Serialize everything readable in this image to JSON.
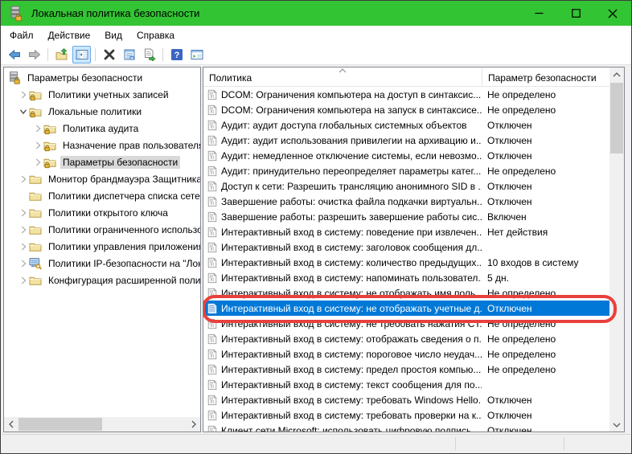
{
  "window": {
    "title": "Локальная политика безопасности"
  },
  "titlebar": {
    "icons": [
      "app-icon-secpol",
      "minimize-icon",
      "maximize-icon",
      "close-icon"
    ]
  },
  "menu": {
    "items": [
      "Файл",
      "Действие",
      "Вид",
      "Справка"
    ]
  },
  "toolbar": {
    "buttons": [
      {
        "name": "back",
        "enabled": true
      },
      {
        "name": "forward",
        "enabled": false
      },
      {
        "name": "up-one-level",
        "enabled": true
      },
      {
        "name": "show-console-tree",
        "enabled": true,
        "active": true
      },
      {
        "name": "delete",
        "enabled": true
      },
      {
        "name": "properties",
        "enabled": true
      },
      {
        "name": "export-list",
        "enabled": true
      },
      {
        "name": "help",
        "enabled": true
      },
      {
        "name": "new-window",
        "enabled": true
      }
    ]
  },
  "tree": {
    "items": [
      {
        "label": "Параметры безопасности",
        "level": 0,
        "expander": "none",
        "icon": "root",
        "selected": false
      },
      {
        "label": "Политики учетных записей",
        "level": 1,
        "expander": "collapsed",
        "icon": "folder-lock",
        "selected": false
      },
      {
        "label": "Локальные политики",
        "level": 1,
        "expander": "expanded",
        "icon": "folder-lock",
        "selected": false
      },
      {
        "label": "Политика аудита",
        "level": 2,
        "expander": "collapsed",
        "icon": "folder-lock",
        "selected": false
      },
      {
        "label": "Назначение прав пользователя",
        "level": 2,
        "expander": "collapsed",
        "icon": "folder-lock",
        "selected": false
      },
      {
        "label": "Параметры безопасности",
        "level": 2,
        "expander": "collapsed",
        "icon": "folder-lock",
        "selected": true
      },
      {
        "label": "Монитор брандмауэра Защитника W",
        "level": 1,
        "expander": "collapsed",
        "icon": "folder",
        "selected": false
      },
      {
        "label": "Политики диспетчера списка сетей",
        "level": 1,
        "expander": "none",
        "icon": "folder",
        "selected": false
      },
      {
        "label": "Политики открытого ключа",
        "level": 1,
        "expander": "collapsed",
        "icon": "folder",
        "selected": false
      },
      {
        "label": "Политики ограниченного использо",
        "level": 1,
        "expander": "collapsed",
        "icon": "folder",
        "selected": false
      },
      {
        "label": "Политики управления приложения",
        "level": 1,
        "expander": "collapsed",
        "icon": "folder",
        "selected": false
      },
      {
        "label": "Политики IP-безопасности на \"Лока",
        "level": 1,
        "expander": "collapsed",
        "icon": "ipsec",
        "selected": false
      },
      {
        "label": "Конфигурация расширенной полит",
        "level": 1,
        "expander": "collapsed",
        "icon": "folder",
        "selected": false
      }
    ]
  },
  "list": {
    "columns": [
      "Политика",
      "Параметр безопасности"
    ],
    "sorted_column": "Политика",
    "rows": [
      {
        "policy": "DCOM: Ограничения компьютера на доступ в синтаксис...",
        "value": "Не определено",
        "selected": false
      },
      {
        "policy": "DCOM: Ограничения компьютера на запуск в синтаксисе...",
        "value": "Не определено",
        "selected": false
      },
      {
        "policy": "Аудит: аудит доступа глобальных системных объектов",
        "value": "Отключен",
        "selected": false
      },
      {
        "policy": "Аудит: аудит использования привилегии на архивацию и...",
        "value": "Отключен",
        "selected": false
      },
      {
        "policy": "Аудит: немедленное отключение системы, если невозмо...",
        "value": "Отключен",
        "selected": false
      },
      {
        "policy": "Аудит: принудительно переопределяет параметры катег...",
        "value": "Не определено",
        "selected": false
      },
      {
        "policy": "Доступ к сети: Разрешить трансляцию анонимного SID в ...",
        "value": "Отключен",
        "selected": false
      },
      {
        "policy": "Завершение работы: очистка файла подкачки виртуальн...",
        "value": "Отключен",
        "selected": false
      },
      {
        "policy": "Завершение работы: разрешить завершение работы сис...",
        "value": "Включен",
        "selected": false
      },
      {
        "policy": "Интерактивный вход в систему:  поведение при извлечен...",
        "value": "Нет действия",
        "selected": false
      },
      {
        "policy": "Интерактивный вход в систему: заголовок сообщения дл...",
        "value": "",
        "selected": false
      },
      {
        "policy": "Интерактивный вход в систему: количество предыдущих...",
        "value": "10 входов в систему",
        "selected": false
      },
      {
        "policy": "Интерактивный вход в систему: напоминать пользовател...",
        "value": "5 дн.",
        "selected": false
      },
      {
        "policy": "Интерактивный вход в систему: не отображать имя поль...",
        "value": "Не определено",
        "selected": false
      },
      {
        "policy": "Интерактивный вход в систему: не отображать учетные д...",
        "value": "Отключен",
        "selected": true
      },
      {
        "policy": "Интерактивный вход в систему: не требовать нажатия CT...",
        "value": "Не определено",
        "selected": false
      },
      {
        "policy": "Интерактивный вход в систему: отображать сведения о п...",
        "value": "Не определено",
        "selected": false
      },
      {
        "policy": "Интерактивный вход в систему: пороговое число неудач...",
        "value": "Не определено",
        "selected": false
      },
      {
        "policy": "Интерактивный вход в систему: предел простоя компью...",
        "value": "Не определено",
        "selected": false
      },
      {
        "policy": "Интерактивный вход в систему: текст сообщения для по...",
        "value": "",
        "selected": false
      },
      {
        "policy": "Интерактивный вход в систему: требовать Windows Hello...",
        "value": "Отключен",
        "selected": false
      },
      {
        "policy": "Интерактивный вход в систему: требовать проверки на к...",
        "value": "Отключен",
        "selected": false
      },
      {
        "policy": "Клиент сети Microsoft: использовать цифровую подпись",
        "value": "Отключен",
        "selected": false
      }
    ]
  },
  "annotation": {
    "shape": "red-rounded-rectangle",
    "color": "#e8413d",
    "target_row": "Интерактивный вход в систему: не отображать учетные д..."
  },
  "colors": {
    "titlebar": "#33c433",
    "selection": "#0078d7",
    "tree_selection": "#d9d9d9",
    "panel_border": "#828790",
    "annotation": "#e8413d"
  }
}
